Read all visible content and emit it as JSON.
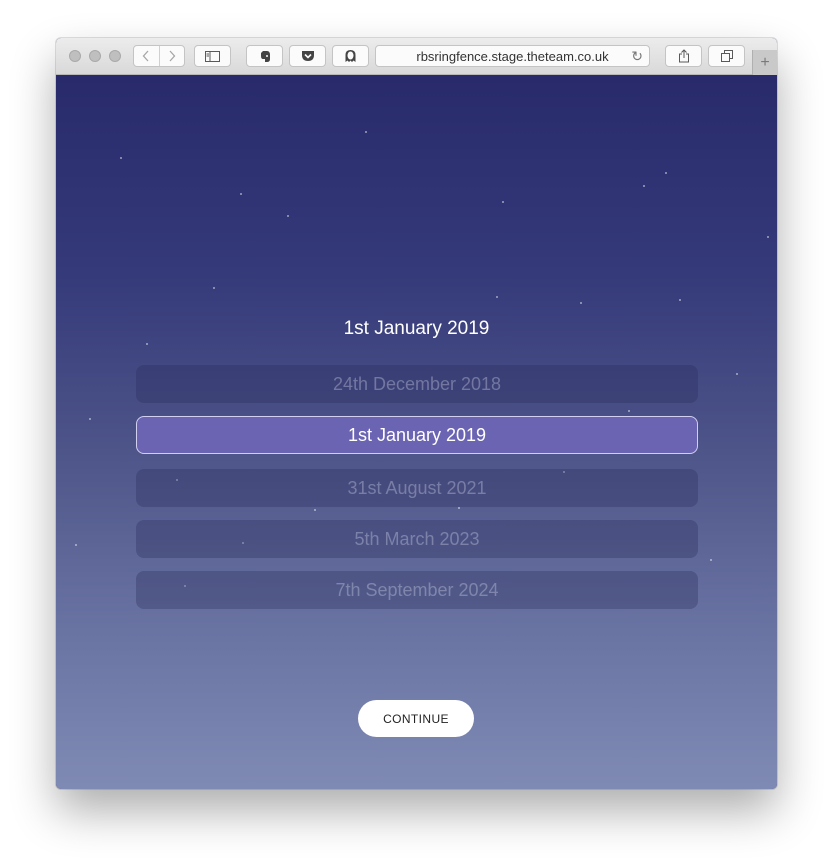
{
  "browser": {
    "url": "rbsringfence.stage.theteam.co.uk",
    "icons": {
      "back": "chevron-left-icon",
      "forward": "chevron-right-icon",
      "sidebar": "sidebar-icon",
      "evernote": "evernote-icon",
      "pocket": "pocket-icon",
      "ghostery": "ghostery-icon",
      "reload": "reload-icon",
      "share": "share-icon",
      "tabs": "tabs-icon",
      "new_tab": "plus-icon"
    }
  },
  "page": {
    "selected_date": "1st January 2019",
    "options": [
      {
        "label": "24th December 2018",
        "active": false
      },
      {
        "label": "1st January 2019",
        "active": true
      },
      {
        "label": "31st August 2021",
        "active": false
      },
      {
        "label": "5th March 2023",
        "active": false
      },
      {
        "label": "7th September 2024",
        "active": false
      }
    ],
    "continue_label": "CONTINUE"
  },
  "colors": {
    "background_top": "#282a6b",
    "background_bottom": "#7f8ab4",
    "active_option": "#6b64b2",
    "button": "#ffffff"
  }
}
